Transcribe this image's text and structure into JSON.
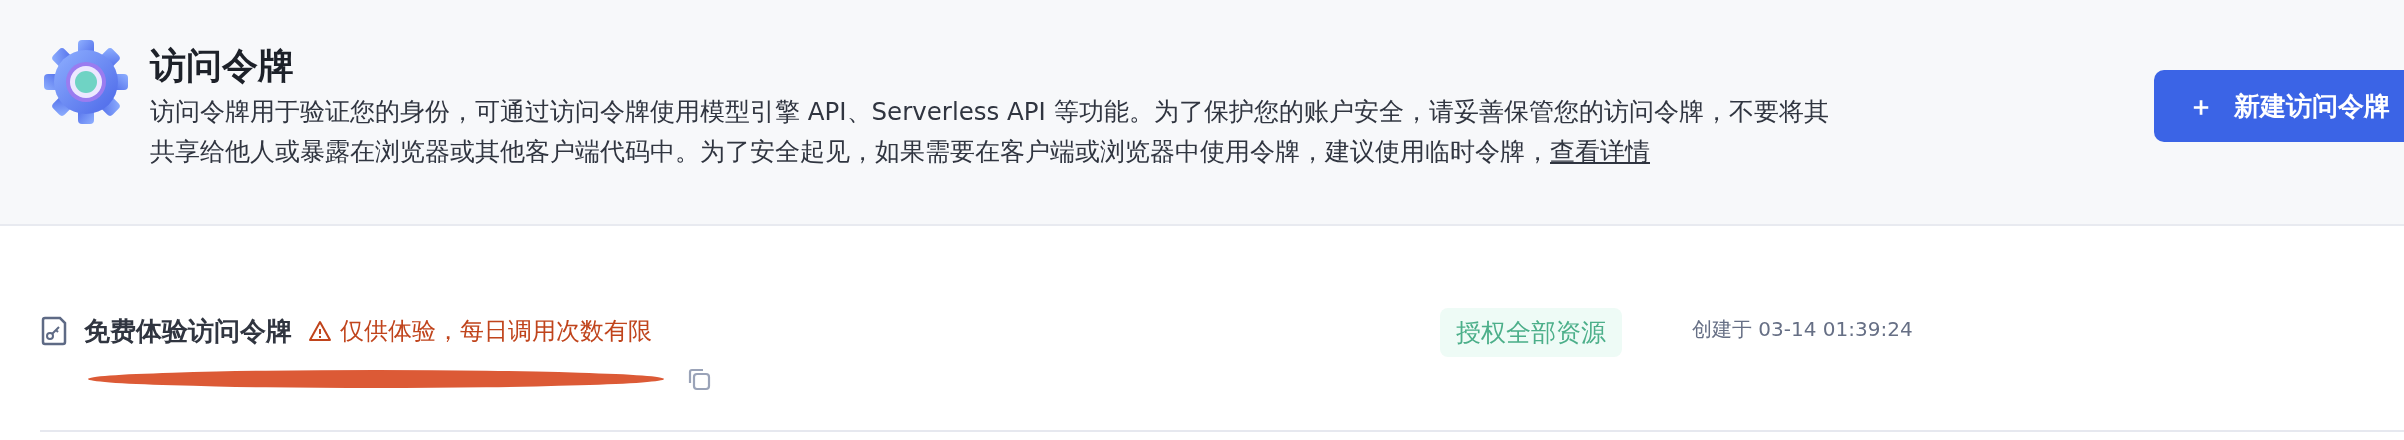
{
  "header": {
    "title": "访问令牌",
    "description": "访问令牌用于验证您的身份，可通过访问令牌使用模型引擎 API、Serverless API 等功能。为了保护您的账户安全，请妥善保管您的访问令牌，不要将其共享给他人或暴露在浏览器或其他客户端代码中。为了安全起见，如果需要在客户端或浏览器中使用令牌，建议使用临时令牌，",
    "link": "查看详情",
    "button": {
      "icon": "＋",
      "label": "新建访问令牌"
    }
  },
  "tokens": [
    {
      "name": "免费体验访问令牌",
      "warning": "仅供体验，每日调用次数有限",
      "key_redacted": true,
      "scope": "授权全部资源",
      "created": "创建于 03-14 01:39:24"
    }
  ]
}
